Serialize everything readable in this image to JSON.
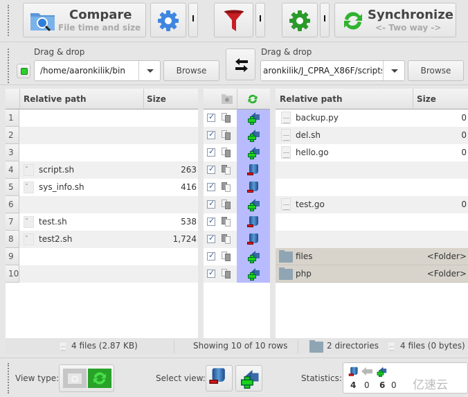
{
  "toolbar": {
    "compare": {
      "title": "Compare",
      "subtitle": "File time and size",
      "icon": "folder-search-icon"
    },
    "compare_settings": {
      "icon": "gear-blue-icon"
    },
    "filter": {
      "icon": "filter-funnel-icon"
    },
    "sync_settings": {
      "icon": "gear-green-icon"
    },
    "synchronize": {
      "title": "Synchronize",
      "subtitle": "<- Two way ->",
      "icon": "sync-arrows-icon"
    }
  },
  "left_path": {
    "label": "Drag & drop",
    "value": "/home/aaronkilik/bin",
    "browse": "Browse"
  },
  "right_path": {
    "label": "Drag & drop",
    "value": "aronkilik/J_CPRA_X86F/scripts",
    "browse": "Browse"
  },
  "swap_icon": "swap-arrows-icon",
  "left_grid": {
    "headers": {
      "path": "Relative path",
      "size": "Size"
    },
    "rows": [
      {
        "num": "1",
        "name": "",
        "size": ""
      },
      {
        "num": "2",
        "name": "",
        "size": ""
      },
      {
        "num": "3",
        "name": "",
        "size": ""
      },
      {
        "num": "4",
        "name": "script.sh",
        "size": "263"
      },
      {
        "num": "5",
        "name": "sys_info.sh",
        "size": "416"
      },
      {
        "num": "6",
        "name": "",
        "size": ""
      },
      {
        "num": "7",
        "name": "test.sh",
        "size": "538"
      },
      {
        "num": "8",
        "name": "test2.sh",
        "size": "1,724"
      },
      {
        "num": "9",
        "name": "",
        "size": ""
      },
      {
        "num": "10",
        "name": "",
        "size": ""
      }
    ]
  },
  "middle_grid": {
    "rows": [
      {
        "checked": true,
        "compare": "right-only",
        "action": "copy-left"
      },
      {
        "checked": true,
        "compare": "right-only",
        "action": "copy-left"
      },
      {
        "checked": true,
        "compare": "right-only",
        "action": "copy-left"
      },
      {
        "checked": true,
        "compare": "left-only",
        "action": "delete"
      },
      {
        "checked": true,
        "compare": "left-only",
        "action": "delete"
      },
      {
        "checked": true,
        "compare": "right-only",
        "action": "copy-left"
      },
      {
        "checked": true,
        "compare": "left-only",
        "action": "delete"
      },
      {
        "checked": true,
        "compare": "left-only",
        "action": "delete"
      },
      {
        "checked": true,
        "compare": "right-only",
        "action": "copy-left"
      },
      {
        "checked": true,
        "compare": "right-only",
        "action": "copy-left"
      }
    ]
  },
  "right_grid": {
    "headers": {
      "path": "Relative path",
      "size": "Size"
    },
    "rows": [
      {
        "name": "backup.py",
        "size": "0",
        "type": "file"
      },
      {
        "name": "del.sh",
        "size": "0",
        "type": "file"
      },
      {
        "name": "hello.go",
        "size": "0",
        "type": "file"
      },
      {
        "name": "",
        "size": "",
        "type": ""
      },
      {
        "name": "",
        "size": "",
        "type": ""
      },
      {
        "name": "test.go",
        "size": "0",
        "type": "file"
      },
      {
        "name": "",
        "size": "",
        "type": ""
      },
      {
        "name": "",
        "size": "",
        "type": ""
      },
      {
        "name": "files",
        "size": "<Folder>",
        "type": "folder"
      },
      {
        "name": "php",
        "size": "<Folder>",
        "type": "folder"
      }
    ]
  },
  "statusbar": {
    "left_files": "4 files (2.87 KB)",
    "showing": "Showing 10 of 10 rows",
    "right_dirs": "2 directories",
    "right_files": "4 files (0 bytes)"
  },
  "bottom": {
    "view_type_label": "View type:",
    "select_view_label": "Select view:",
    "statistics_label": "Statistics:",
    "stats": {
      "delete_left": "4",
      "overwrite_left": "0",
      "create_left": "6",
      "other": "0"
    },
    "watermark": "亿速云"
  },
  "colors": {
    "action_column": "#b8bcff",
    "folder_row": "#d8d4cc"
  }
}
